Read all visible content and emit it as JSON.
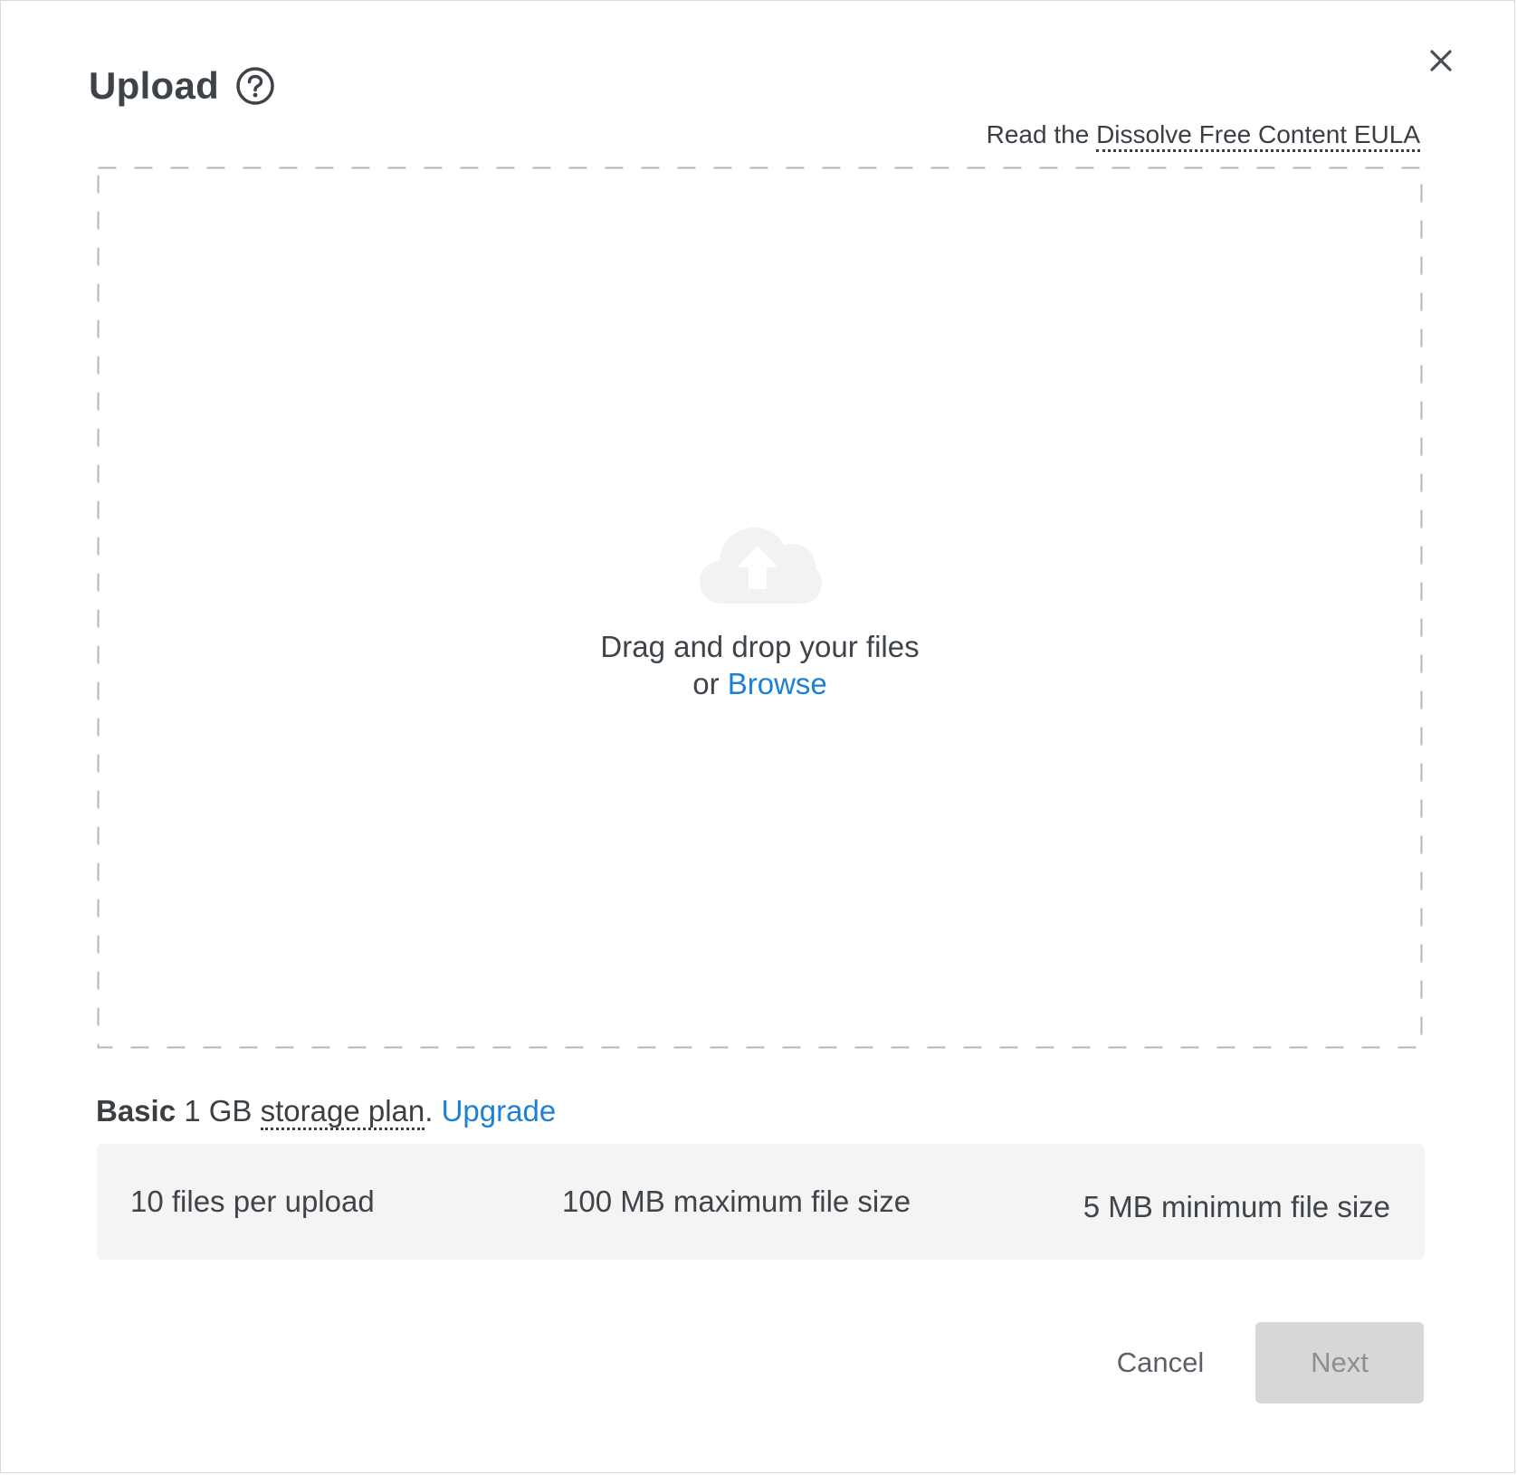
{
  "dialog": {
    "title": "Upload",
    "help_icon": "question-circle-icon",
    "close_icon": "close-icon"
  },
  "eula": {
    "prefix": "Read the ",
    "link": "Dissolve Free Content EULA"
  },
  "dropzone": {
    "icon": "cloud-upload-icon",
    "line1": "Drag and drop your files",
    "line2_prefix": "or ",
    "browse": "Browse"
  },
  "plan": {
    "name": "Basic",
    "size": " 1 GB ",
    "storage_link": "storage plan",
    "period": ". ",
    "upgrade": "Upgrade"
  },
  "limits": [
    "10 files per upload",
    "100 MB maximum file size",
    "5 MB minimum file size"
  ],
  "footer": {
    "cancel": "Cancel",
    "next": "Next"
  },
  "colors": {
    "link": "#1d7fd6",
    "next_disabled_bg": "#d7d7d7",
    "limits_bg": "#f4f4f4"
  }
}
